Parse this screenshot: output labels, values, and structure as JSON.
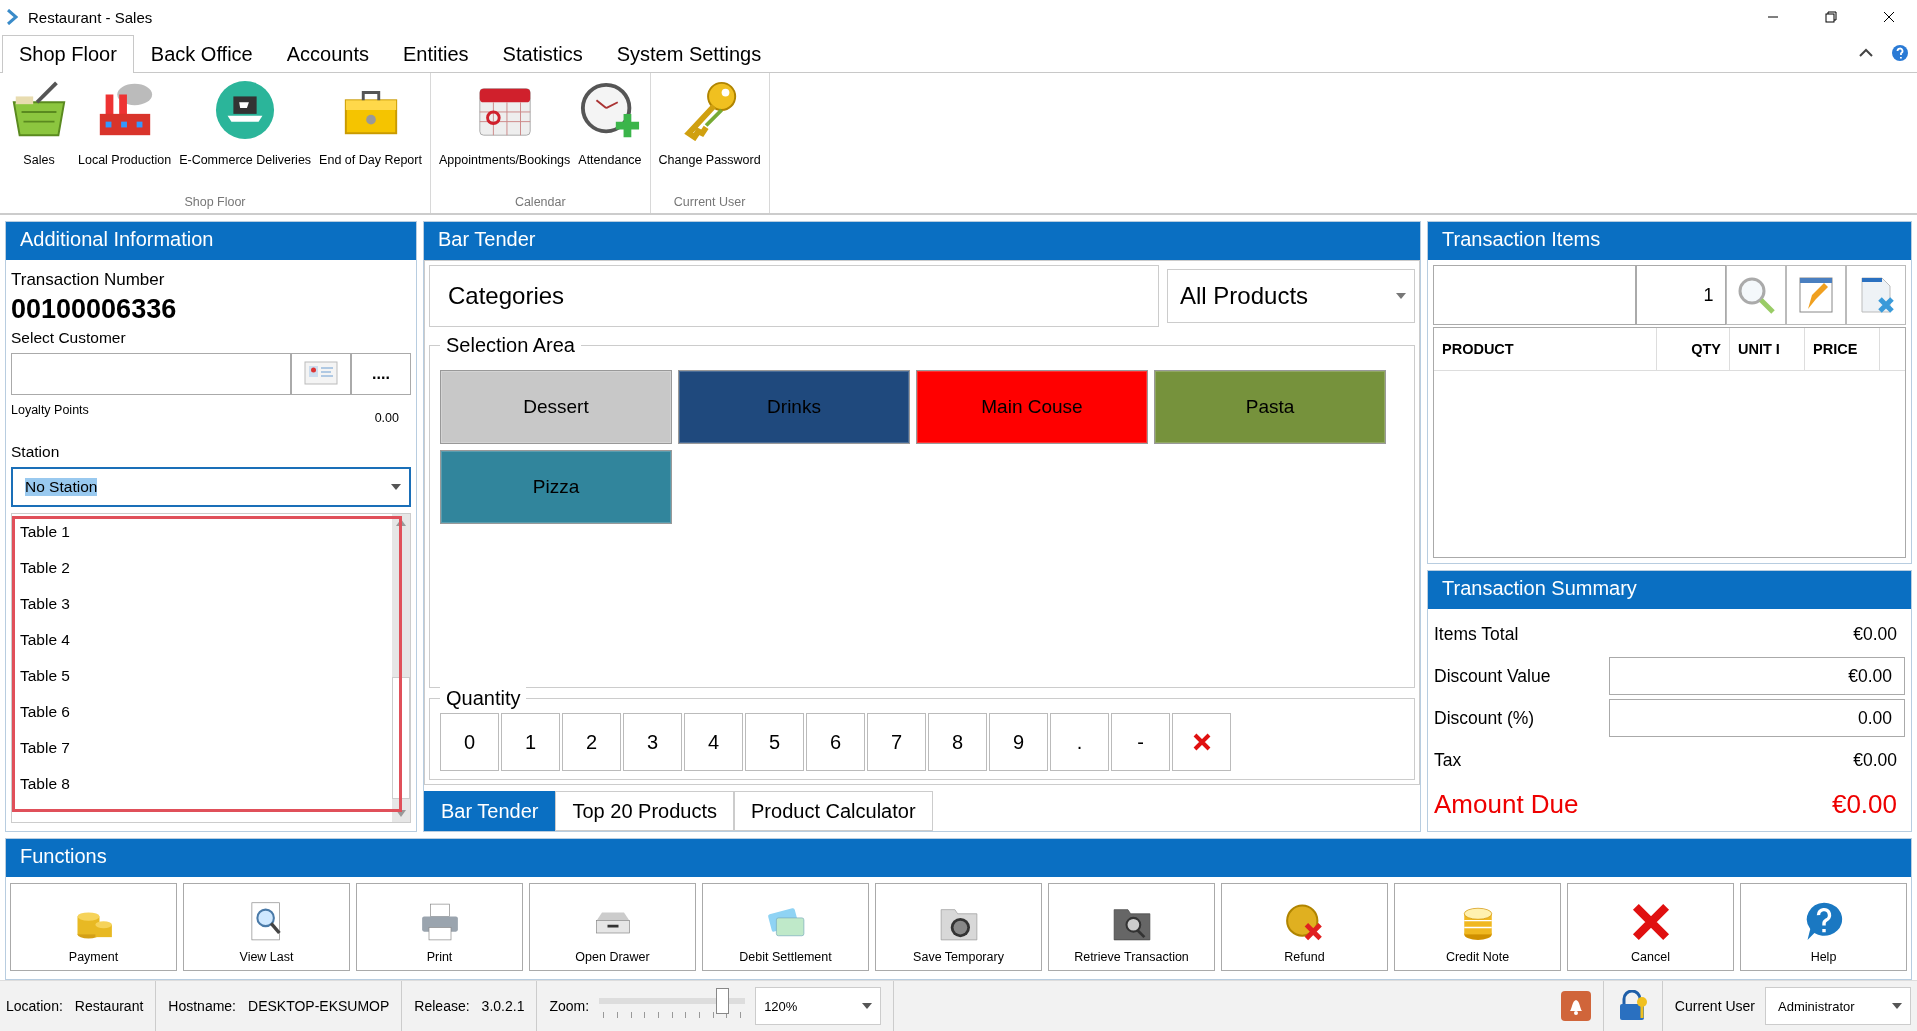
{
  "window": {
    "title": "Restaurant - Sales"
  },
  "ribbon_tabs": [
    {
      "label": "Shop Floor",
      "selected": true
    },
    {
      "label": "Back Office",
      "selected": false
    },
    {
      "label": "Accounts",
      "selected": false
    },
    {
      "label": "Entities",
      "selected": false
    },
    {
      "label": "Statistics",
      "selected": false
    },
    {
      "label": "System Settings",
      "selected": false
    }
  ],
  "ribbon_groups": [
    {
      "label": "Shop Floor",
      "items": [
        {
          "label": "Sales",
          "kind": "basket"
        },
        {
          "label": "Local Production",
          "kind": "factory"
        },
        {
          "label": "E-Commerce Deliveries",
          "kind": "laptop"
        },
        {
          "label": "End of Day Report",
          "kind": "cashbox"
        }
      ]
    },
    {
      "label": "Calendar",
      "items": [
        {
          "label": "Appointments/Bookings",
          "kind": "calendar"
        },
        {
          "label": "Attendance",
          "kind": "clock"
        }
      ]
    },
    {
      "label": "Current User",
      "items": [
        {
          "label": "Change Password",
          "kind": "key"
        }
      ]
    }
  ],
  "additional_info": {
    "title": "Additional Information",
    "transaction_label": "Transaction Number",
    "transaction_number": "00100006336",
    "customer_label": "Select Customer",
    "customer_more": "....",
    "loyalty_label": "Loyalty Points",
    "loyalty_value": "0.00",
    "station_label": "Station",
    "station_value": "No Station",
    "stations": [
      "Table 1",
      "Table 2",
      "Table 3",
      "Table 4",
      "Table 5",
      "Table 6",
      "Table 7",
      "Table 8"
    ]
  },
  "bar_tender": {
    "title": "Bar Tender",
    "categories_label": "Categories",
    "product_filter": "All Products",
    "selection_label": "Selection Area",
    "categories": [
      {
        "label": "Dessert",
        "color": "#c8c8c8"
      },
      {
        "label": "Drinks",
        "color": "#1f497d"
      },
      {
        "label": "Main Couse",
        "color": "#ff0000"
      },
      {
        "label": "Pasta",
        "color": "#76923c"
      },
      {
        "label": "Pizza",
        "color": "#31859c"
      }
    ],
    "quantity_label": "Quantity",
    "keys": [
      {
        "kind": "key",
        "label": "0"
      },
      {
        "kind": "key",
        "label": "1"
      },
      {
        "kind": "key",
        "label": "2"
      },
      {
        "kind": "key",
        "label": "3"
      },
      {
        "kind": "key",
        "label": "4"
      },
      {
        "kind": "key",
        "label": "5"
      },
      {
        "kind": "key",
        "label": "6"
      },
      {
        "kind": "key",
        "label": "7"
      },
      {
        "kind": "key",
        "label": "8"
      },
      {
        "kind": "key",
        "label": "9"
      },
      {
        "kind": "key",
        "label": "."
      },
      {
        "kind": "key",
        "label": "-"
      },
      {
        "kind": "clear"
      }
    ],
    "tabs": [
      {
        "label": "Bar Tender",
        "selected": true
      },
      {
        "label": "Top 20 Products",
        "selected": false
      },
      {
        "label": "Product Calculator",
        "selected": false
      }
    ]
  },
  "transaction_items": {
    "title": "Transaction Items",
    "quantity": "1",
    "columns": [
      "PRODUCT",
      "QTY",
      "UNIT I",
      "PRICE"
    ]
  },
  "transaction_summary": {
    "title": "Transaction Summary",
    "rows": [
      {
        "label": "Items Total",
        "value": "€0.00",
        "kind": "text"
      },
      {
        "label": "Discount Value",
        "value": "€0.00",
        "kind": "field"
      },
      {
        "label": "Discount (%)",
        "value": "0.00",
        "kind": "field"
      },
      {
        "label": "Tax",
        "value": "€0.00",
        "kind": "text"
      },
      {
        "label": "Amount Due",
        "value": "€0.00",
        "kind": "total"
      }
    ]
  },
  "functions": {
    "title": "Functions",
    "buttons": [
      {
        "label": "Payment",
        "kind": "coins"
      },
      {
        "label": "View Last",
        "kind": "magnifier"
      },
      {
        "label": "Print",
        "kind": "printer"
      },
      {
        "label": "Open Drawer",
        "kind": "drawer"
      },
      {
        "label": "Debit Settlement",
        "kind": "card"
      },
      {
        "label": "Save Temporary",
        "kind": "folder-clock"
      },
      {
        "label": "Retrieve Transaction",
        "kind": "folder-search"
      },
      {
        "label": "Refund",
        "kind": "coin-cross"
      },
      {
        "label": "Credit Note",
        "kind": "chips"
      },
      {
        "label": "Cancel",
        "kind": "cross"
      },
      {
        "label": "Help",
        "kind": "help"
      }
    ]
  },
  "status_bar": {
    "location_label": "Location:",
    "location": "Restaurant",
    "hostname_label": "Hostname:",
    "hostname": "DESKTOP-EKSUMOP",
    "release_label": "Release:",
    "release": "3.0.2.1",
    "zoom_label": "Zoom:",
    "zoom": {
      "level": 0.84,
      "value": "120%"
    },
    "user_label": "Current User",
    "user": "Administrator"
  }
}
